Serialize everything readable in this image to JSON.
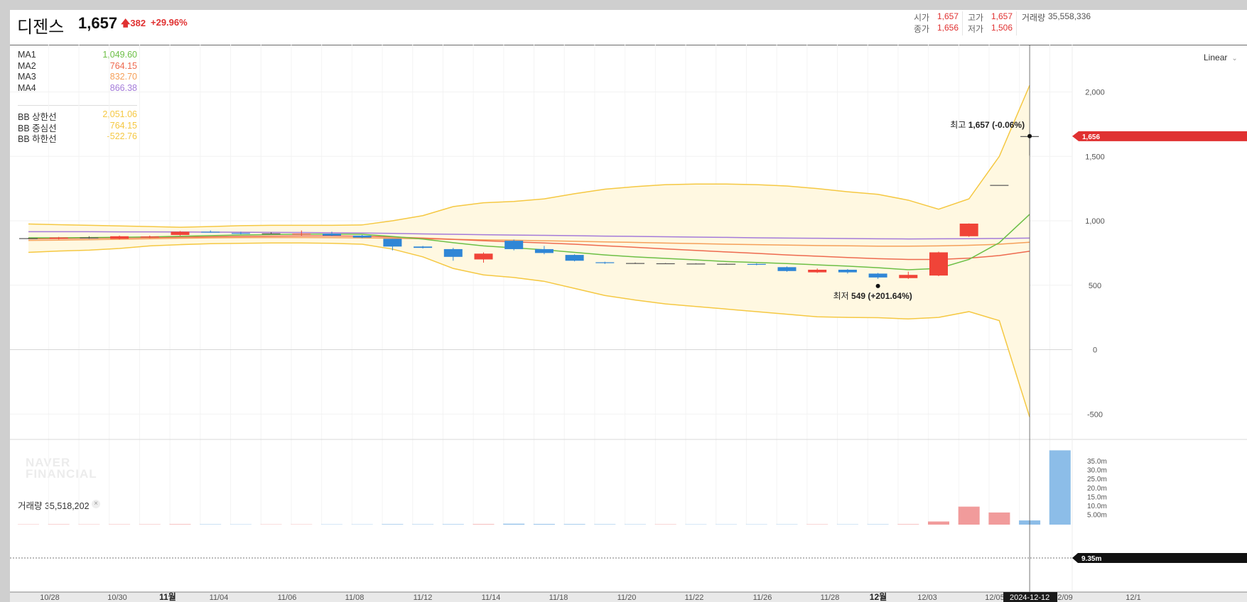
{
  "stock": {
    "name": "디젠스",
    "price": "1,657",
    "change": "382",
    "change_pct": "+29.96%",
    "open_label": "시가",
    "open": "1,657",
    "high_label": "고가",
    "high": "1,657",
    "close_label": "종가",
    "close": "1,656",
    "low_label": "저가",
    "low": "1,506",
    "volume_label": "거래량",
    "volume": "35,558,336"
  },
  "indicators": [
    {
      "label": "MA1",
      "value": "1,049.60",
      "color": "#6cbf45"
    },
    {
      "label": "MA2",
      "value": "764.15",
      "color": "#ee6a4f"
    },
    {
      "label": "MA3",
      "value": "832.70",
      "color": "#f5a05a"
    },
    {
      "label": "MA4",
      "value": "866.38",
      "color": "#a47bd9"
    },
    {
      "label": "BB 상한선",
      "value": "2,051.06",
      "color": "#f5c842"
    },
    {
      "label": "BB 중심선",
      "value": "764.15",
      "color": "#f5c842"
    },
    {
      "label": "BB 하한선",
      "value": "-522.76",
      "color": "#f5c842"
    }
  ],
  "scale_mode": "Linear",
  "volume_panel": {
    "label": "거래량 35,518,202",
    "close_icon": "close-icon"
  },
  "watermark": "NAVER\nFINANCIAL",
  "colors": {
    "up": "#f04438",
    "down": "#2f86d6",
    "bb": "#f5c842",
    "bb_fill": "#fff8e1"
  },
  "chart_data": {
    "type": "candlestick",
    "y_axis": {
      "ticks": [
        2000,
        1500,
        1000,
        500,
        0,
        -500
      ],
      "tick_labels": [
        "2,000",
        "1,500",
        "1,000",
        "500",
        "0",
        "-500"
      ],
      "range": [
        -685,
        2400
      ]
    },
    "x_labels": [
      "10/28",
      "10/30",
      "11월",
      "11/04",
      "11/06",
      "11/08",
      "11/12",
      "11/14",
      "11/18",
      "11/20",
      "11/22",
      "11/26",
      "11/28",
      "12월",
      "12/03",
      "12/05",
      "12/09",
      "12/1"
    ],
    "x_label_bold": [
      "11월",
      "12월"
    ],
    "volume_axis": {
      "tick_labels": [
        "35.0m",
        "30.0m",
        "25.0m",
        "20.0m",
        "15.0m",
        "10.0m",
        "5.00m"
      ]
    },
    "candles": [
      {
        "o": 865,
        "h": 868,
        "l": 862,
        "c": 865
      },
      {
        "o": 862,
        "h": 875,
        "l": 855,
        "c": 870
      },
      {
        "o": 868,
        "h": 880,
        "l": 860,
        "c": 870
      },
      {
        "o": 860,
        "h": 885,
        "l": 855,
        "c": 880
      },
      {
        "o": 872,
        "h": 885,
        "l": 865,
        "c": 878
      },
      {
        "o": 890,
        "h": 920,
        "l": 885,
        "c": 915
      },
      {
        "o": 915,
        "h": 925,
        "l": 908,
        "c": 910
      },
      {
        "o": 905,
        "h": 915,
        "l": 895,
        "c": 902
      },
      {
        "o": 902,
        "h": 912,
        "l": 895,
        "c": 902
      },
      {
        "o": 895,
        "h": 925,
        "l": 885,
        "c": 900
      },
      {
        "o": 900,
        "h": 915,
        "l": 880,
        "c": 885
      },
      {
        "o": 885,
        "h": 890,
        "l": 865,
        "c": 870
      },
      {
        "o": 860,
        "h": 860,
        "l": 770,
        "c": 800
      },
      {
        "o": 800,
        "h": 805,
        "l": 785,
        "c": 790
      },
      {
        "o": 780,
        "h": 790,
        "l": 690,
        "c": 720
      },
      {
        "o": 700,
        "h": 755,
        "l": 675,
        "c": 745
      },
      {
        "o": 845,
        "h": 855,
        "l": 770,
        "c": 780
      },
      {
        "o": 780,
        "h": 805,
        "l": 740,
        "c": 750
      },
      {
        "o": 735,
        "h": 740,
        "l": 685,
        "c": 690
      },
      {
        "o": 678,
        "h": 682,
        "l": 665,
        "c": 672
      },
      {
        "o": 672,
        "h": 676,
        "l": 666,
        "c": 670
      },
      {
        "o": 668,
        "h": 672,
        "l": 664,
        "c": 670
      },
      {
        "o": 668,
        "h": 670,
        "l": 664,
        "c": 667
      },
      {
        "o": 666,
        "h": 668,
        "l": 662,
        "c": 664
      },
      {
        "o": 665,
        "h": 670,
        "l": 655,
        "c": 662
      },
      {
        "o": 640,
        "h": 645,
        "l": 605,
        "c": 610
      },
      {
        "o": 600,
        "h": 630,
        "l": 595,
        "c": 620
      },
      {
        "o": 620,
        "h": 625,
        "l": 590,
        "c": 600
      },
      {
        "o": 590,
        "h": 595,
        "l": 549,
        "c": 560
      },
      {
        "o": 555,
        "h": 605,
        "l": 549,
        "c": 580
      },
      {
        "o": 575,
        "h": 760,
        "l": 570,
        "c": 755
      },
      {
        "o": 880,
        "h": 980,
        "l": 875,
        "c": 978
      },
      {
        "o": 1278,
        "h": 1278,
        "l": 1278,
        "c": 1278
      },
      {
        "o": 1657,
        "h": 1657,
        "l": 1506,
        "c": 1656
      }
    ],
    "ma1": [
      868,
      868,
      870,
      872,
      875,
      880,
      885,
      890,
      893,
      896,
      897,
      895,
      878,
      858,
      830,
      805,
      790,
      775,
      755,
      735,
      720,
      708,
      696,
      684,
      676,
      668,
      658,
      648,
      636,
      620,
      630,
      700,
      830,
      1050
    ],
    "ma2": [
      860,
      862,
      865,
      868,
      870,
      873,
      876,
      879,
      881,
      882,
      882,
      880,
      874,
      866,
      856,
      845,
      836,
      828,
      818,
      806,
      794,
      782,
      770,
      758,
      747,
      735,
      725,
      715,
      706,
      700,
      700,
      710,
      730,
      764
    ],
    "ma3": [
      848,
      850,
      853,
      857,
      860,
      864,
      867,
      869,
      870,
      870,
      869,
      867,
      864,
      860,
      856,
      852,
      849,
      845,
      841,
      836,
      832,
      827,
      823,
      818,
      815,
      811,
      808,
      806,
      803,
      803,
      805,
      810,
      818,
      833
    ],
    "ma4": [
      915,
      915,
      915,
      914,
      914,
      913,
      912,
      911,
      910,
      909,
      907,
      905,
      902,
      898,
      895,
      892,
      889,
      887,
      884,
      881,
      879,
      876,
      873,
      871,
      868,
      866,
      864,
      862,
      860,
      859,
      860,
      861,
      863,
      866
    ],
    "bb_upper": [
      975,
      970,
      965,
      960,
      955,
      950,
      955,
      962,
      965,
      965,
      965,
      968,
      1000,
      1040,
      1110,
      1140,
      1150,
      1170,
      1210,
      1245,
      1265,
      1280,
      1285,
      1285,
      1280,
      1270,
      1250,
      1225,
      1205,
      1160,
      1090,
      1170,
      1500,
      2051
    ],
    "bb_lower": [
      755,
      765,
      772,
      785,
      805,
      815,
      822,
      825,
      828,
      828,
      825,
      818,
      780,
      720,
      630,
      580,
      560,
      530,
      475,
      420,
      385,
      355,
      335,
      315,
      295,
      275,
      255,
      250,
      248,
      238,
      250,
      295,
      225,
      -523
    ],
    "volumes": [
      0.12,
      0.15,
      0.12,
      0.13,
      0.14,
      0.2,
      0.15,
      0.12,
      0.11,
      0.11,
      0.12,
      0.12,
      0.22,
      0.16,
      0.2,
      0.22,
      0.42,
      0.3,
      0.25,
      0.18,
      0.14,
      0.14,
      0.12,
      0.12,
      0.12,
      0.13,
      0.14,
      0.13,
      0.15,
      0.2,
      1.5,
      8.6,
      5.8,
      2.0,
      35.5
    ],
    "last_price_tag": "1,656",
    "volume_tag": "9.35m",
    "crosshair_date": "2024-12-12",
    "high_annotation": {
      "label": "최고",
      "value": "1,657 (-0.06%)"
    },
    "low_annotation": {
      "label": "최저",
      "value": "549 (+201.64%)"
    }
  }
}
